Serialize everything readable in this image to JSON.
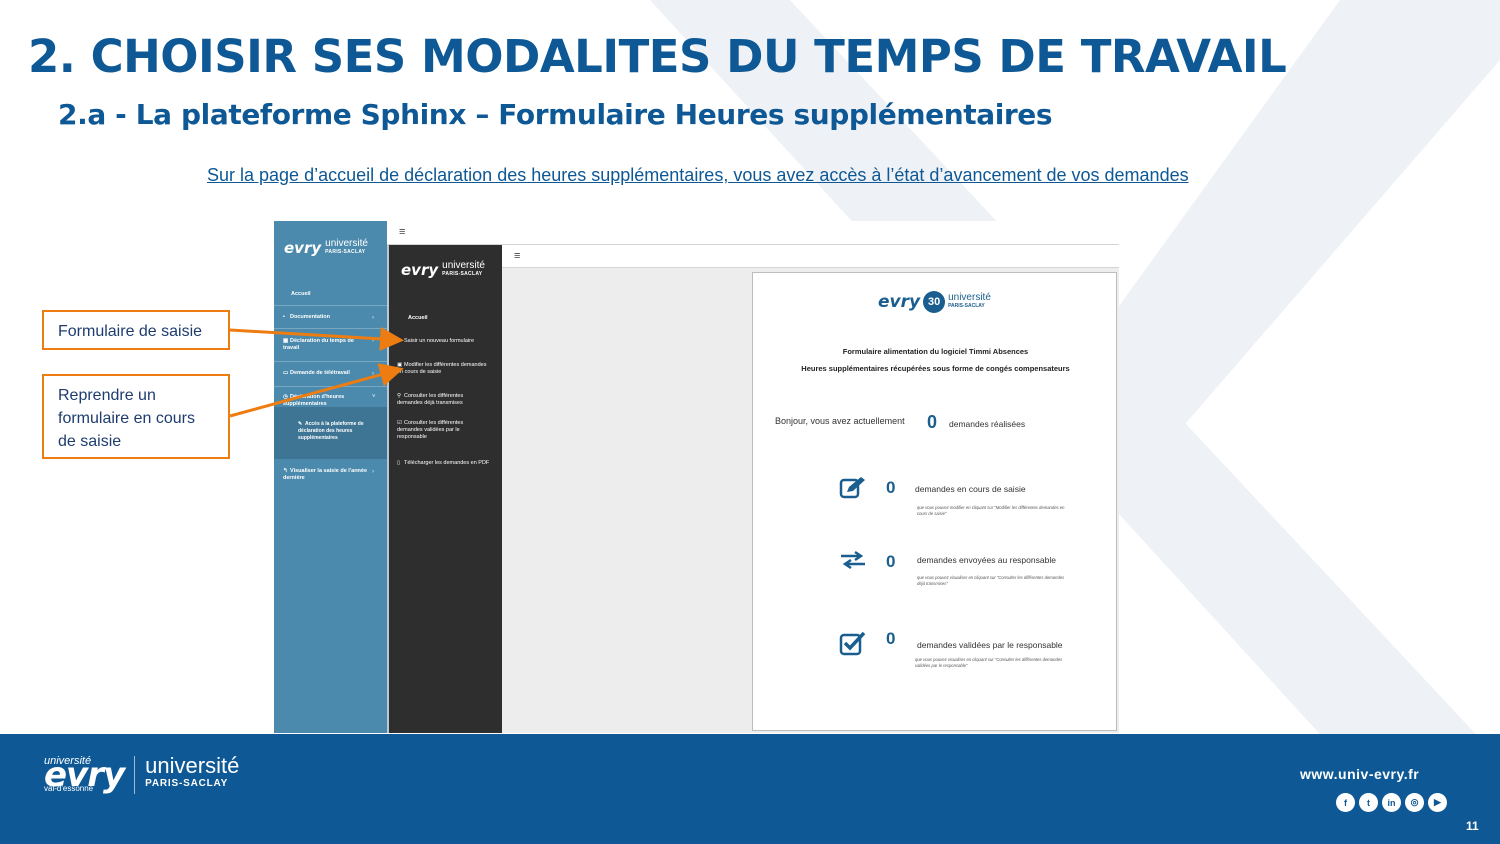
{
  "slide": {
    "title": "2. CHOISIR SES MODALITES DU TEMPS DE TRAVAIL",
    "subtitle": "2.a - La plateforme Sphinx – Formulaire Heures supplémentaires",
    "intro": "Sur la page d’accueil de déclaration des heures supplémentaires, vous avez accès à l’état d’avancement de vos demandes",
    "page_number": "11",
    "brand_color": "#0e5895",
    "accent_color": "#ee7d11"
  },
  "callouts": [
    {
      "text": "Formulaire de saisie"
    },
    {
      "text": "Reprendre un formulaire en cours de saisie"
    }
  ],
  "logo": {
    "evry": "evry",
    "universite": "université",
    "paris_saclay": "PARIS-SACLAY"
  },
  "sidebar1": {
    "home": "Accueil",
    "items": [
      {
        "label": "Documentation",
        "icon": "book-icon"
      },
      {
        "label": "Déclaration du temps de travail",
        "icon": "calendar-icon"
      },
      {
        "label": "Demande de télétravail",
        "icon": "laptop-icon"
      },
      {
        "label": "Déclaration d'heures supplémentaires",
        "icon": "clock-icon"
      },
      {
        "label": "Accès à la plateforme de déclaration des heures supplémentaires",
        "icon": "edit-icon"
      },
      {
        "label": "Visualiser la saisie de l'année dernière",
        "icon": "back-icon"
      }
    ]
  },
  "sidebar2": {
    "home": "Accueil",
    "items": [
      {
        "label": "Saisir un nouveau formulaire",
        "icon": "check-icon"
      },
      {
        "label": "Modifier les différentes demandes en cours de saisie",
        "icon": "edit-icon"
      },
      {
        "label": "Consulter les différentes demandes déjà transmises",
        "icon": "search-icon"
      },
      {
        "label": "Consulter les différentes demandes validées par le responsable",
        "icon": "edit-icon"
      },
      {
        "label": "Télécharger les demandes en PDF",
        "icon": "file-icon"
      }
    ]
  },
  "menu_icon": "≡",
  "panel": {
    "badge": "30",
    "title1": "Formulaire alimentation du logiciel Timmi Absences",
    "title2": "Heures supplémentaires récupérées sous forme de congés compensateurs",
    "greeting": "Bonjour, vous avez actuellement",
    "total": "0",
    "total_label": "demandes réalisées",
    "stats": [
      {
        "value": "0",
        "label": "demandes en cours de saisie",
        "note": "que vous pouvez modifier en cliquant sur \"Modifier les différentes demandes en cours de saisie\"",
        "icon": "edit-square-icon"
      },
      {
        "value": "0",
        "label": "demandes envoyées au responsable",
        "note": "que vous pouvez visualiser en cliquant sur \"Consulter les différentes demandes déjà transmises\"",
        "icon": "exchange-arrows-icon"
      },
      {
        "value": "0",
        "label": "demandes validées par le responsable",
        "note": "que vous pouvez visualiser en cliquant sur \"Consulter les différentes demandes validées par le responsable\"",
        "icon": "checked-box-icon"
      }
    ]
  },
  "footer": {
    "url": "www.univ-evry.fr",
    "socials": [
      "f",
      "t",
      "in",
      "◎",
      "▶"
    ],
    "university_word": "université",
    "location": "val-d'essonne"
  }
}
